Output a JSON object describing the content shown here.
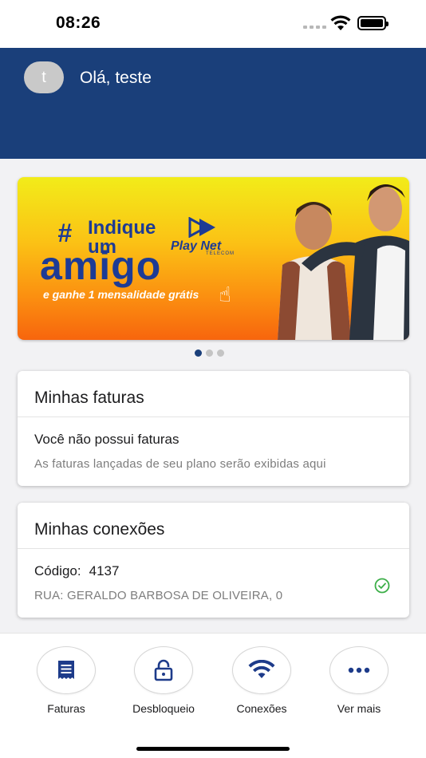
{
  "status_bar": {
    "time": "08:26"
  },
  "header": {
    "avatar_initial": "t",
    "greeting": "Olá, teste"
  },
  "banner": {
    "hash": "#",
    "indique_line1": "Indique",
    "indique_line2": "um",
    "amigo": "amigo",
    "tagline": "e ganhe 1 mensalidade grátis",
    "brand": "Play Net",
    "brand_sub": "TELECOM",
    "pager": {
      "total": 3,
      "active": 0
    }
  },
  "faturas": {
    "title": "Minhas faturas",
    "message": "Você não possui faturas",
    "sub": "As faturas lançadas de seu plano serão exibidas aqui"
  },
  "conexoes": {
    "title": "Minhas conexões",
    "code_label": "Código:",
    "code_value": "4137",
    "address": "RUA: GERALDO BARBOSA DE OLIVEIRA, 0",
    "status_icon": "check-circle-icon",
    "status_color": "#3cae48"
  },
  "nav": {
    "items": [
      {
        "label": "Faturas",
        "icon": "invoice-icon"
      },
      {
        "label": "Desbloqueio",
        "icon": "unlock-icon"
      },
      {
        "label": "Conexões",
        "icon": "wifi-icon"
      },
      {
        "label": "Ver mais",
        "icon": "more-icon"
      }
    ]
  },
  "colors": {
    "primary": "#1a3f7a",
    "accent_icon": "#1d3b8a",
    "success": "#3cae48"
  }
}
